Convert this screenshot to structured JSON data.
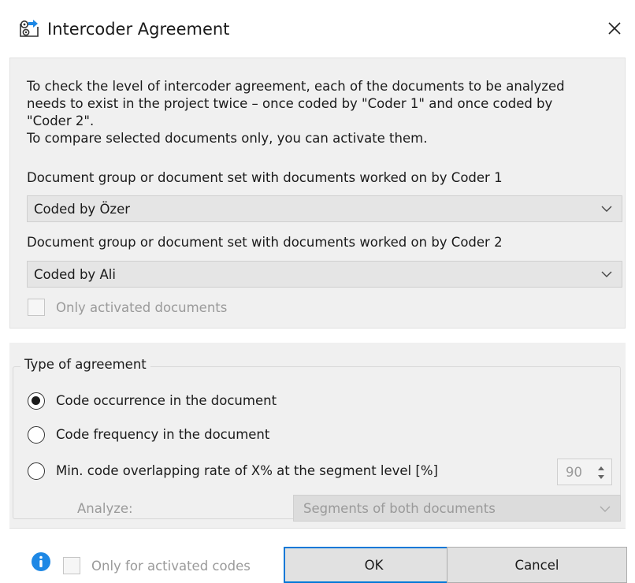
{
  "window": {
    "title": "Intercoder Agreement",
    "icon": "intercoder-icon",
    "close_icon": "close-icon"
  },
  "intro": {
    "lines": [
      "To check the level of intercoder agreement, each of the documents to be analyzed",
      "needs to exist in the project twice – once coded by \"Coder 1\" and once coded by",
      "\"Coder 2\".",
      "To compare selected documents only, you can activate them."
    ]
  },
  "coder1": {
    "label": "Document group or document set with documents worked on by Coder 1",
    "value": "Coded by Özer"
  },
  "coder2": {
    "label": "Document group or document set with documents worked on by Coder 2",
    "value": "Coded by Ali"
  },
  "only_activated_documents": {
    "label": "Only activated documents",
    "checked": false,
    "enabled": false
  },
  "agreement": {
    "title": "Type of agreement",
    "options": [
      {
        "label": "Code occurrence in the document",
        "checked": true
      },
      {
        "label": "Code frequency in the document",
        "checked": false
      },
      {
        "label": "Min. code overlapping rate of X% at the segment level [%]",
        "checked": false
      }
    ],
    "overlap_rate": "90",
    "analyze_label": "Analyze:",
    "analyze_value": "Segments of both documents"
  },
  "footer": {
    "info_icon": "info-icon",
    "only_activated_codes": "Only for activated codes",
    "ok": "OK",
    "cancel": "Cancel"
  },
  "colors": {
    "panel": "#f0f0f0",
    "accent": "#0078d7",
    "info": "#1e88e5",
    "disabled_text": "#9a9a9a"
  }
}
